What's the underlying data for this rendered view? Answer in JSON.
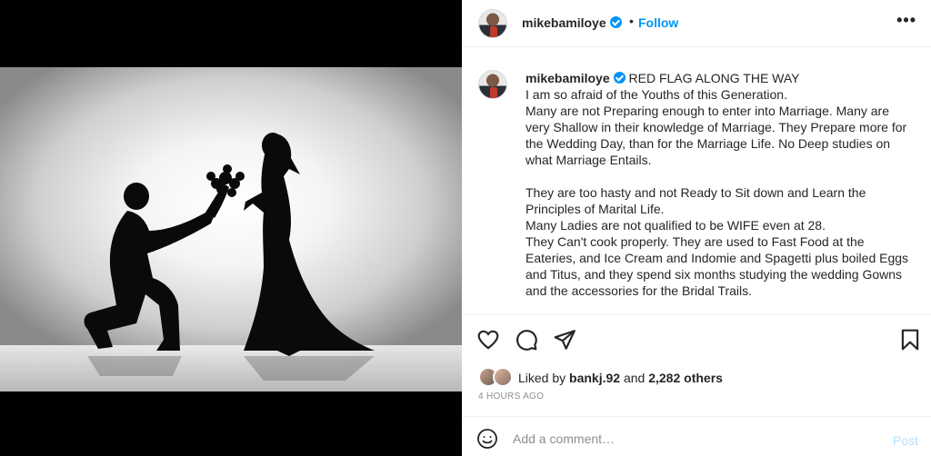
{
  "post": {
    "username": "mikebamiloye",
    "follow_label": "Follow",
    "more_label": "•••",
    "dot": "•"
  },
  "caption": {
    "username": "mikebamiloye",
    "lines": [
      "RED FLAG ALONG THE WAY",
      "I am so afraid of the Youths of this Generation.",
      "Many are not Preparing enough to enter into Marriage. Many are very Shallow in their knowledge of Marriage. They Prepare more for the Wedding Day, than for the Marriage Life. No Deep studies on what Marriage Entails.",
      "They are too hasty and not Ready to Sit down and Learn the Principles of Marital Life.",
      "Many Ladies are not qualified to be WIFE even at 28.",
      "They Can't cook properly. They are used to Fast Food at the Eateries, and Ice Cream and Indomie and Spagetti plus boiled Eggs and Titus, and they spend six months studying the wedding Gowns and the accessories for the Bridal Trails."
    ]
  },
  "icons": {
    "like": "heart-icon",
    "comment": "comment-icon",
    "share": "paper-plane-icon",
    "save": "bookmark-icon",
    "emoji": "smiley-icon"
  },
  "likes": {
    "prefix": "Liked by ",
    "user": "bankj.92",
    "middle": " and ",
    "count": "2,282 others"
  },
  "timestamp": "4 HOURS AGO",
  "comment": {
    "placeholder": "Add a comment…",
    "post_label": "Post"
  },
  "colors": {
    "accent": "#0095f6",
    "post_disabled": "#b2dffc",
    "muted": "#8e8e8e"
  }
}
